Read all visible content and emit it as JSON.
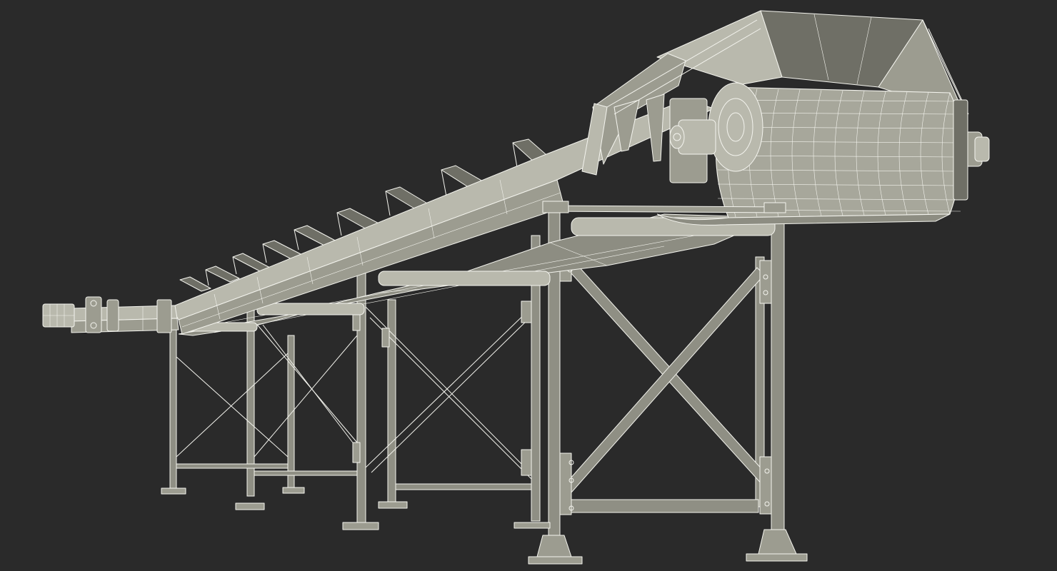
{
  "scene": {
    "subject": "belt-conveyor",
    "render_style": "wireframe-over-shaded",
    "colors": {
      "background": "#2a2a2a",
      "wire": "#f4f4ee",
      "surface": "#9c9c90",
      "surface_light": "#b9b9ad",
      "surface_dark": "#6f6f66"
    }
  }
}
